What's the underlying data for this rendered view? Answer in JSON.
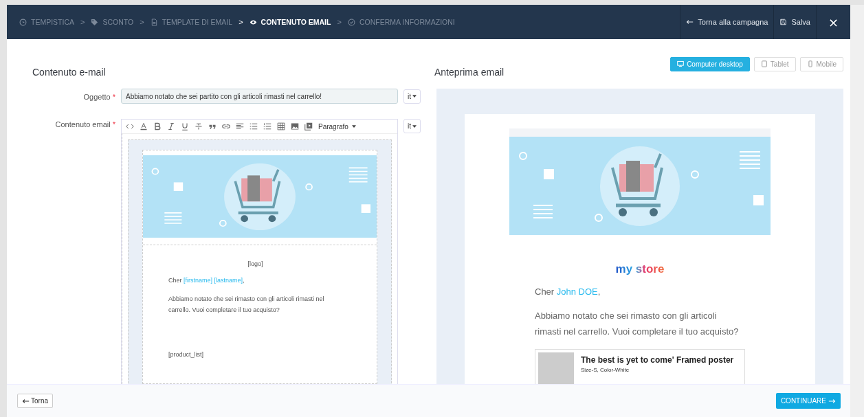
{
  "steps": [
    {
      "label": "TEMPISTICA",
      "kind": "clock",
      "selected": false
    },
    {
      "label": "SCONTO",
      "kind": "tag",
      "selected": false
    },
    {
      "label": "TEMPLATE DI EMAIL",
      "kind": "document",
      "selected": false
    },
    {
      "label": "CONTENUTO EMAIL",
      "kind": "eye",
      "selected": true
    },
    {
      "label": "CONFERMA INFORMAZIONI",
      "kind": "check",
      "selected": false
    }
  ],
  "step_separator": ">",
  "header_actions": [
    {
      "label": "Torna alla campagna",
      "kind": "arrow"
    },
    {
      "label": "Salva",
      "kind": "save"
    }
  ],
  "close": "×",
  "editor": {
    "title": "Contenuto e-mail",
    "subject": {
      "label": "Oggetto",
      "required_mark": "*",
      "value": "Abbiamo notato che sei partito con gli articoli rimasti nel carrello!",
      "language": "it"
    },
    "content": {
      "label": "Contenuto email",
      "required_mark": "*",
      "language": "it",
      "format": "Paragrafo",
      "email": {
        "logo": "[logo]",
        "greeting": {
          "salutation": "Cher",
          "name": "[firstname] [lastname]",
          "suffix": ","
        },
        "body": "Abbiamo notato che sei rimasto con gli articoli rimasti nel carrello. Vuoi completare il tuo acquisto?",
        "product_list": "[product_list]"
      }
    }
  },
  "preview": {
    "title": "Anteprima email",
    "devices": [
      {
        "label": "Computer desktop",
        "kind": "monitor",
        "selected": true
      },
      {
        "label": "Tablet",
        "kind": "tablet",
        "selected": false
      },
      {
        "label": "Mobile",
        "kind": "phone",
        "selected": false
      }
    ],
    "email": {
      "logo": "my store",
      "greeting": {
        "salutation": "Cher",
        "name": "John DOE",
        "suffix": ","
      },
      "body": "Abbiamo notato che sei rimasto con gli articoli rimasti nel carrello. Vuoi completare il tuo acquisto?",
      "product": {
        "name": "The best is yet to come' Framed poster",
        "variant": "Size-S, Color-White"
      }
    }
  },
  "footer": {
    "back": "Torna",
    "next": "CONTINUARE"
  }
}
